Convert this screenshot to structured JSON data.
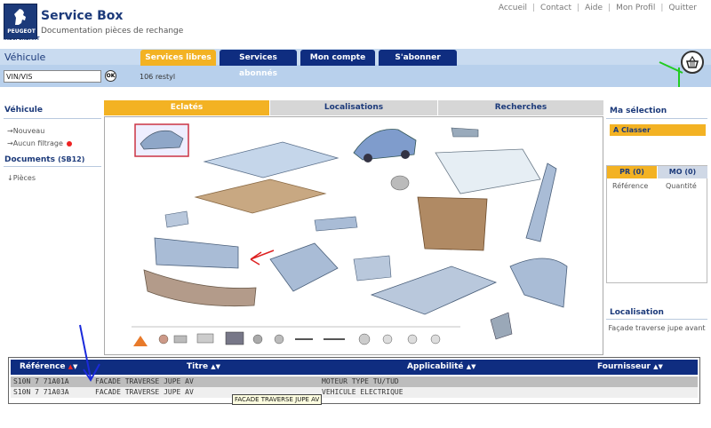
{
  "header": {
    "logo_text": "PEUGEOT",
    "logo_subtext": "INDÉPENDANT",
    "app_title": "Service Box",
    "app_subtitle": "Documentation pièces de rechange",
    "top_links": [
      "Accueil",
      "Contact",
      "Aide",
      "Mon Profil",
      "Quitter"
    ]
  },
  "nav": {
    "section_label": "Véhicule",
    "tabs": [
      "Services libres",
      "Services abonnés",
      "Mon compte",
      "S'abonner"
    ],
    "vin_value": "VIN/VIS",
    "ok_label": "OK",
    "model": "106 restyl",
    "basket_icon": "basket-icon"
  },
  "left": {
    "vehicule_title": "Véhicule",
    "links": [
      "Nouveau",
      "Aucun filtrage"
    ],
    "documents_title": "Documents",
    "documents_code": "(SB12)",
    "doc_links": [
      "Pièces"
    ]
  },
  "center": {
    "tabs": [
      "Eclatés",
      "Localisations",
      "Recherches"
    ]
  },
  "right": {
    "title": "Ma sélection",
    "a_classer": "A Classer",
    "pr_tab": "PR (0)",
    "mo_tab": "MO (0)",
    "col_reference": "Référence",
    "col_quantite": "Quantité",
    "localisation_title": "Localisation",
    "localisation_text": "Façade traverse jupe avant"
  },
  "table": {
    "headers": [
      "Référence",
      "Titre",
      "Applicabilité",
      "Fournisseur"
    ],
    "rows": [
      [
        "S10N 7 71A01A",
        "FACADE TRAVERSE JUPE AV",
        "MOTEUR TYPE TU/TUD",
        ""
      ],
      [
        "S10N 7 71A03A",
        "FACADE TRAVERSE JUPE AV",
        "VEHICULE ELECTRIQUE",
        ""
      ]
    ],
    "tooltip": "FACADE TRAVERSE JUPE AV"
  },
  "colors": {
    "navy": "#0f2d80",
    "amber": "#f3b223",
    "light_blue": "#b8d0ec"
  }
}
